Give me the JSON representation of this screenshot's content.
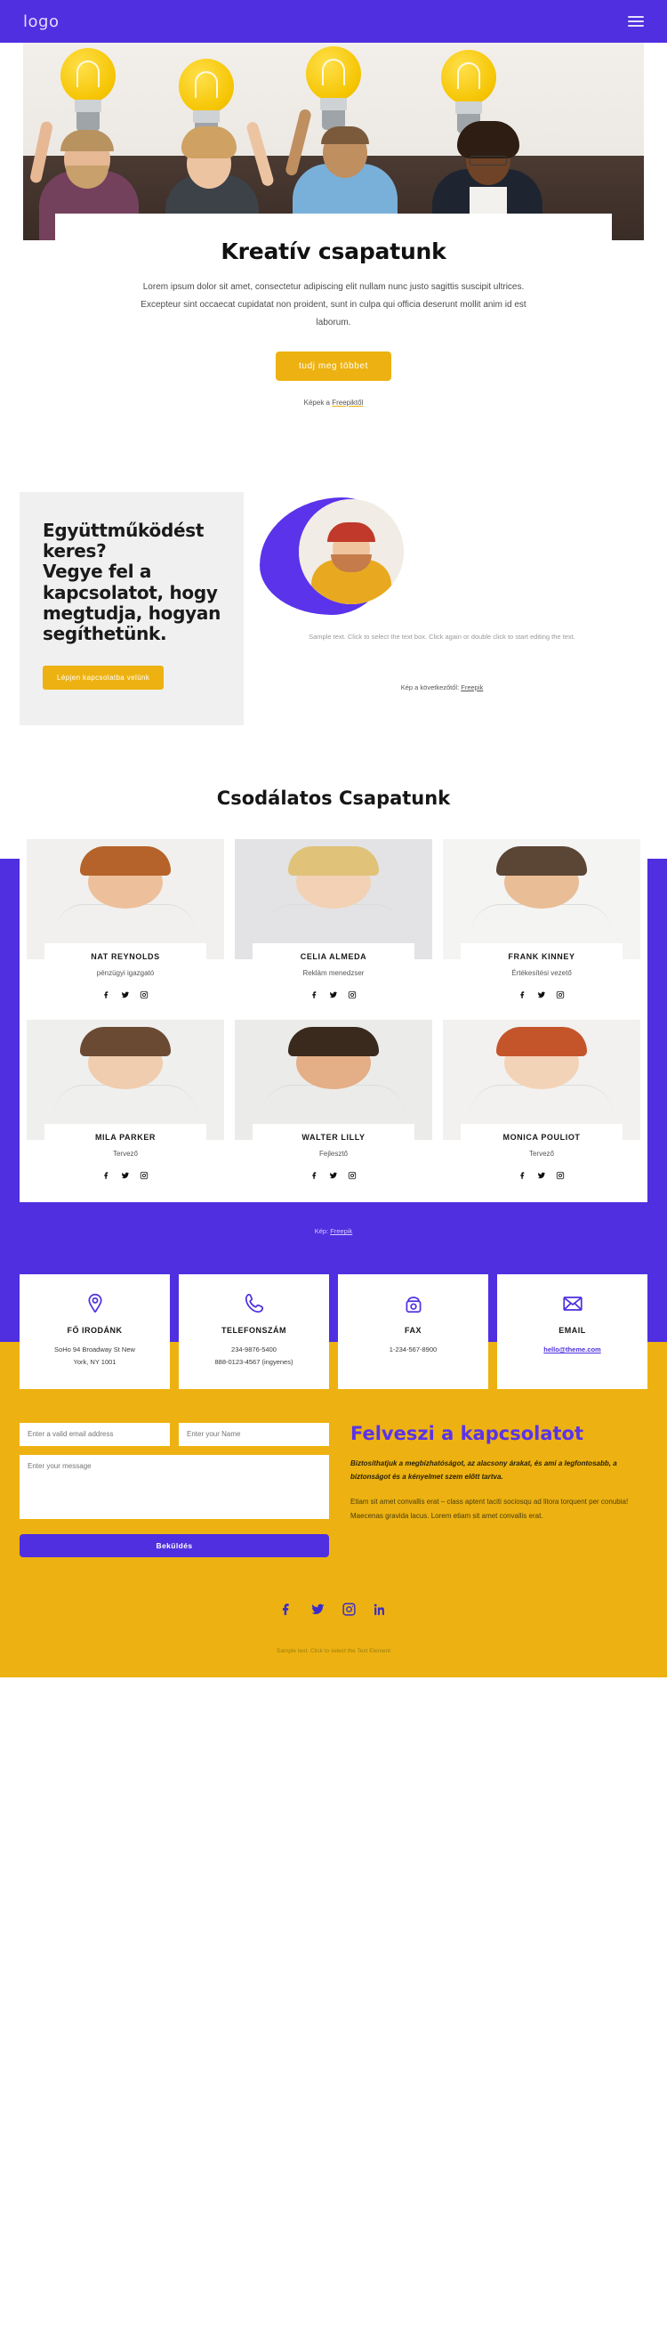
{
  "header": {
    "logo": "logo",
    "menu_icon": "hamburger-icon"
  },
  "hero": {
    "title": "Kreatív csapatunk",
    "description": "Lorem ipsum dolor sit amet, consectetur adipiscing elit nullam nunc justo sagittis suscipit ultrices. Excepteur sint occaecat cupidatat non proident, sunt in culpa qui officia deserunt mollit anim id est laborum.",
    "cta_label": "tudj meg többet",
    "credit_prefix": "Képek a ",
    "credit_link": "Freepiktől"
  },
  "collab": {
    "title": "Együttműködést keres?\nVegye fel a kapcsolatot, hogy megtudja, hogyan segíthetünk.",
    "cta_label": "Lépjen kapcsolatba velünk",
    "sample_text": "Sample text. Click to select the text box. Click again or double click to start editing the text.",
    "credit_prefix": "Kép a következőtől: ",
    "credit_link": "Freepik"
  },
  "team": {
    "heading": "Csodálatos Csapatunk",
    "members": [
      {
        "name": "NAT REYNOLDS",
        "role": "pénzügyi igazgató"
      },
      {
        "name": "CELIA ALMEDA",
        "role": "Reklám menedzser"
      },
      {
        "name": "FRANK KINNEY",
        "role": "Értékesítési vezető"
      },
      {
        "name": "MILA PARKER",
        "role": "Tervező"
      },
      {
        "name": "WALTER LILLY",
        "role": "Fejlesztő"
      },
      {
        "name": "MONICA POULIOT",
        "role": "Tervező"
      }
    ],
    "social_icons": [
      "facebook-icon",
      "twitter-icon",
      "instagram-icon"
    ],
    "credit_prefix": "Kép: ",
    "credit_link": "Freepik"
  },
  "contact_cards": [
    {
      "icon": "location-pin-icon",
      "title": "FŐ IRODÁNK",
      "line1": "SoHo 94 Broadway St New",
      "line2": "York, NY 1001",
      "is_link": false
    },
    {
      "icon": "phone-icon",
      "title": "TELEFONSZÁM",
      "line1": "234-9876-5400",
      "line2": "888-0123-4567 (ingyenes)",
      "is_link": false
    },
    {
      "icon": "fax-icon",
      "title": "FAX",
      "line1": "1-234-567-8900",
      "line2": "",
      "is_link": false
    },
    {
      "icon": "envelope-icon",
      "title": "EMAIL",
      "line1": "hello@theme.com",
      "line2": "",
      "is_link": true
    }
  ],
  "form": {
    "email_placeholder": "Enter a valid email address",
    "name_placeholder": "Enter your Name",
    "message_placeholder": "Enter your message",
    "submit_label": "Beküldés"
  },
  "cta": {
    "title": "Felveszi a kapcsolatot",
    "bold_text": "Biztosíthatjuk a megbízhatóságot, az alacsony árakat, és ami a legfontosabb, a biztonságot és a kényelmet szem előtt tartva.",
    "body_text": "Etiam sit amet convallis erat – class aptent taciti sociosqu ad litora torquent per conubia! Maecenas gravida lacus. Lorem etiam sit amet convallis erat."
  },
  "footer": {
    "socials": [
      "facebook-icon",
      "twitter-icon",
      "instagram-icon",
      "linkedin-icon"
    ],
    "note": "Sample text. Click to select the Text Element"
  },
  "colors": {
    "purple": "#4f2fe0",
    "amber": "#edb211",
    "violet": "#5a33ea"
  }
}
